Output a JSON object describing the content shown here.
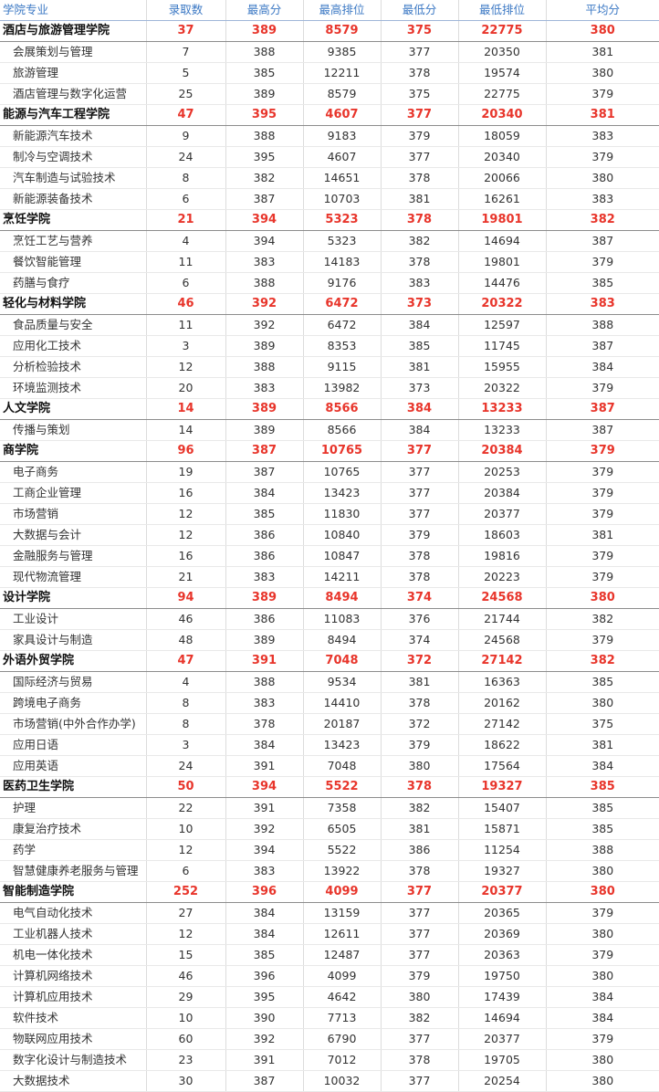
{
  "headers": [
    "学院专业",
    "录取数",
    "最高分",
    "最高排位",
    "最低分",
    "最低排位",
    "平均分"
  ],
  "colors": {
    "header_text": "#3b78c4",
    "college_values": "#e8352b"
  },
  "groups": [
    {
      "college": [
        "酒店与旅游管理学院",
        "37",
        "389",
        "8579",
        "375",
        "22775",
        "380"
      ],
      "majors": [
        [
          "会展策划与管理",
          "7",
          "388",
          "9385",
          "377",
          "20350",
          "381"
        ],
        [
          "旅游管理",
          "5",
          "385",
          "12211",
          "378",
          "19574",
          "380"
        ],
        [
          "酒店管理与数字化运营",
          "25",
          "389",
          "8579",
          "375",
          "22775",
          "379"
        ]
      ]
    },
    {
      "college": [
        "能源与汽车工程学院",
        "47",
        "395",
        "4607",
        "377",
        "20340",
        "381"
      ],
      "majors": [
        [
          "新能源汽车技术",
          "9",
          "388",
          "9183",
          "379",
          "18059",
          "383"
        ],
        [
          "制冷与空调技术",
          "24",
          "395",
          "4607",
          "377",
          "20340",
          "379"
        ],
        [
          "汽车制造与试验技术",
          "8",
          "382",
          "14651",
          "378",
          "20066",
          "380"
        ],
        [
          "新能源装备技术",
          "6",
          "387",
          "10703",
          "381",
          "16261",
          "383"
        ]
      ]
    },
    {
      "college": [
        "烹饪学院",
        "21",
        "394",
        "5323",
        "378",
        "19801",
        "382"
      ],
      "majors": [
        [
          "烹饪工艺与营养",
          "4",
          "394",
          "5323",
          "382",
          "14694",
          "387"
        ],
        [
          "餐饮智能管理",
          "11",
          "383",
          "14183",
          "378",
          "19801",
          "379"
        ],
        [
          "药膳与食疗",
          "6",
          "388",
          "9176",
          "383",
          "14476",
          "385"
        ]
      ]
    },
    {
      "college": [
        "轻化与材料学院",
        "46",
        "392",
        "6472",
        "373",
        "20322",
        "383"
      ],
      "majors": [
        [
          "食品质量与安全",
          "11",
          "392",
          "6472",
          "384",
          "12597",
          "388"
        ],
        [
          "应用化工技术",
          "3",
          "389",
          "8353",
          "385",
          "11745",
          "387"
        ],
        [
          "分析检验技术",
          "12",
          "388",
          "9115",
          "381",
          "15955",
          "384"
        ],
        [
          "环境监测技术",
          "20",
          "383",
          "13982",
          "373",
          "20322",
          "379"
        ]
      ]
    },
    {
      "college": [
        "人文学院",
        "14",
        "389",
        "8566",
        "384",
        "13233",
        "387"
      ],
      "majors": [
        [
          "传播与策划",
          "14",
          "389",
          "8566",
          "384",
          "13233",
          "387"
        ]
      ]
    },
    {
      "college": [
        "商学院",
        "96",
        "387",
        "10765",
        "377",
        "20384",
        "379"
      ],
      "majors": [
        [
          "电子商务",
          "19",
          "387",
          "10765",
          "377",
          "20253",
          "379"
        ],
        [
          "工商企业管理",
          "16",
          "384",
          "13423",
          "377",
          "20384",
          "379"
        ],
        [
          "市场营销",
          "12",
          "385",
          "11830",
          "377",
          "20377",
          "379"
        ],
        [
          "大数据与会计",
          "12",
          "386",
          "10840",
          "379",
          "18603",
          "381"
        ],
        [
          "金融服务与管理",
          "16",
          "386",
          "10847",
          "378",
          "19816",
          "379"
        ],
        [
          "现代物流管理",
          "21",
          "383",
          "14211",
          "378",
          "20223",
          "379"
        ]
      ]
    },
    {
      "college": [
        "设计学院",
        "94",
        "389",
        "8494",
        "374",
        "24568",
        "380"
      ],
      "majors": [
        [
          "工业设计",
          "46",
          "386",
          "11083",
          "376",
          "21744",
          "382"
        ],
        [
          "家具设计与制造",
          "48",
          "389",
          "8494",
          "374",
          "24568",
          "379"
        ]
      ]
    },
    {
      "college": [
        "外语外贸学院",
        "47",
        "391",
        "7048",
        "372",
        "27142",
        "382"
      ],
      "majors": [
        [
          "国际经济与贸易",
          "4",
          "388",
          "9534",
          "381",
          "16363",
          "385"
        ],
        [
          "跨境电子商务",
          "8",
          "383",
          "14410",
          "378",
          "20162",
          "380"
        ],
        [
          "市场营销(中外合作办学)",
          "8",
          "378",
          "20187",
          "372",
          "27142",
          "375"
        ],
        [
          "应用日语",
          "3",
          "384",
          "13423",
          "379",
          "18622",
          "381"
        ],
        [
          "应用英语",
          "24",
          "391",
          "7048",
          "380",
          "17564",
          "384"
        ]
      ]
    },
    {
      "college": [
        "医药卫生学院",
        "50",
        "394",
        "5522",
        "378",
        "19327",
        "385"
      ],
      "majors": [
        [
          "护理",
          "22",
          "391",
          "7358",
          "382",
          "15407",
          "385"
        ],
        [
          "康复治疗技术",
          "10",
          "392",
          "6505",
          "381",
          "15871",
          "385"
        ],
        [
          "药学",
          "12",
          "394",
          "5522",
          "386",
          "11254",
          "388"
        ],
        [
          "智慧健康养老服务与管理",
          "6",
          "383",
          "13922",
          "378",
          "19327",
          "380"
        ]
      ]
    },
    {
      "college": [
        "智能制造学院",
        "252",
        "396",
        "4099",
        "377",
        "20377",
        "380"
      ],
      "majors": [
        [
          "电气自动化技术",
          "27",
          "384",
          "13159",
          "377",
          "20365",
          "379"
        ],
        [
          "工业机器人技术",
          "12",
          "384",
          "12611",
          "377",
          "20369",
          "380"
        ],
        [
          "机电一体化技术",
          "15",
          "385",
          "12487",
          "377",
          "20363",
          "379"
        ],
        [
          "计算机网络技术",
          "46",
          "396",
          "4099",
          "379",
          "19750",
          "380"
        ],
        [
          "计算机应用技术",
          "29",
          "395",
          "4642",
          "380",
          "17439",
          "384"
        ],
        [
          "软件技术",
          "10",
          "390",
          "7713",
          "382",
          "14694",
          "384"
        ],
        [
          "物联网应用技术",
          "60",
          "392",
          "6790",
          "377",
          "20377",
          "379"
        ],
        [
          "数字化设计与制造技术",
          "23",
          "391",
          "7012",
          "378",
          "19705",
          "380"
        ],
        [
          "大数据技术",
          "30",
          "387",
          "10032",
          "377",
          "20254",
          "380"
        ]
      ]
    }
  ]
}
